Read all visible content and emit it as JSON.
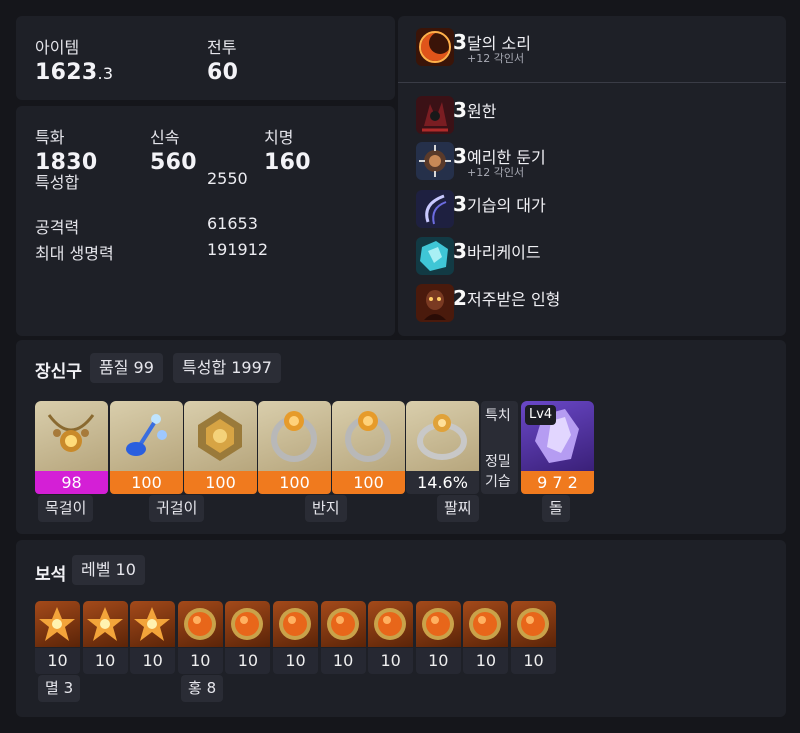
{
  "stats_top": {
    "item_label": "아이템",
    "item_level_main": "1623",
    "item_level_decimal": ".3",
    "combat_label": "전투",
    "combat_level": "60"
  },
  "stats": {
    "spec_label": "특화",
    "spec_value": "1830",
    "swift_label": "신속",
    "swift_value": "560",
    "crit_label": "치명",
    "crit_value": "160",
    "sum_label": "특성합",
    "sum_value": "2550",
    "attack_label": "공격력",
    "attack_value": "61653",
    "hp_label": "최대 생명력",
    "hp_value": "191912"
  },
  "engravings": [
    {
      "level": "3",
      "name": "달의 소리",
      "sub": "+12 각인서",
      "icon": "moon-sound-icon"
    },
    {
      "level": "3",
      "name": "원한",
      "sub": "",
      "icon": "grudge-icon"
    },
    {
      "level": "3",
      "name": "예리한 둔기",
      "sub": "+12 각인서",
      "icon": "keen-blunt-icon"
    },
    {
      "level": "3",
      "name": "기습의 대가",
      "sub": "",
      "icon": "master-ambush-icon"
    },
    {
      "level": "3",
      "name": "바리케이드",
      "sub": "",
      "icon": "barricade-icon"
    },
    {
      "level": "2",
      "name": "저주받은 인형",
      "sub": "",
      "icon": "cursed-doll-icon"
    }
  ],
  "accessories": {
    "title": "장신구",
    "quality_chip": "품질 99",
    "sum_chip": "특성합 1997",
    "items": [
      {
        "icon": "necklace-icon",
        "quality": "98",
        "color": "#d41fd6"
      },
      {
        "icon": "earring-icon",
        "quality": "100",
        "color": "#f07a1e"
      },
      {
        "icon": "earring-icon",
        "quality": "100",
        "color": "#f07a1e"
      },
      {
        "icon": "ring-icon",
        "quality": "100",
        "color": "#f07a1e"
      },
      {
        "icon": "ring-icon",
        "quality": "100",
        "color": "#f07a1e"
      },
      {
        "icon": "bracelet-icon",
        "quality": "14.6%",
        "color": "#2a2c35"
      }
    ],
    "bracelet_effects": [
      "특치",
      "정밀",
      "기습"
    ],
    "stone": {
      "icon": "ability-stone-icon",
      "level": "Lv4",
      "values": "9 7 2",
      "color": "#f07a1e"
    },
    "tags": {
      "necklace": "목걸이",
      "earring": "귀걸이",
      "ring": "반지",
      "bracelet": "팔찌",
      "stone": "돌"
    }
  },
  "gems": {
    "title": "보석",
    "level_chip": "레벨 10",
    "items": [
      {
        "type": "annihilation",
        "level": "10"
      },
      {
        "type": "annihilation",
        "level": "10"
      },
      {
        "type": "annihilation",
        "level": "10"
      },
      {
        "type": "crimson",
        "level": "10"
      },
      {
        "type": "crimson",
        "level": "10"
      },
      {
        "type": "crimson",
        "level": "10"
      },
      {
        "type": "crimson",
        "level": "10"
      },
      {
        "type": "crimson",
        "level": "10"
      },
      {
        "type": "crimson",
        "level": "10"
      },
      {
        "type": "crimson",
        "level": "10"
      },
      {
        "type": "crimson",
        "level": "10"
      }
    ],
    "tags": {
      "annihilation": "멸 3",
      "crimson": "홍 8"
    }
  }
}
